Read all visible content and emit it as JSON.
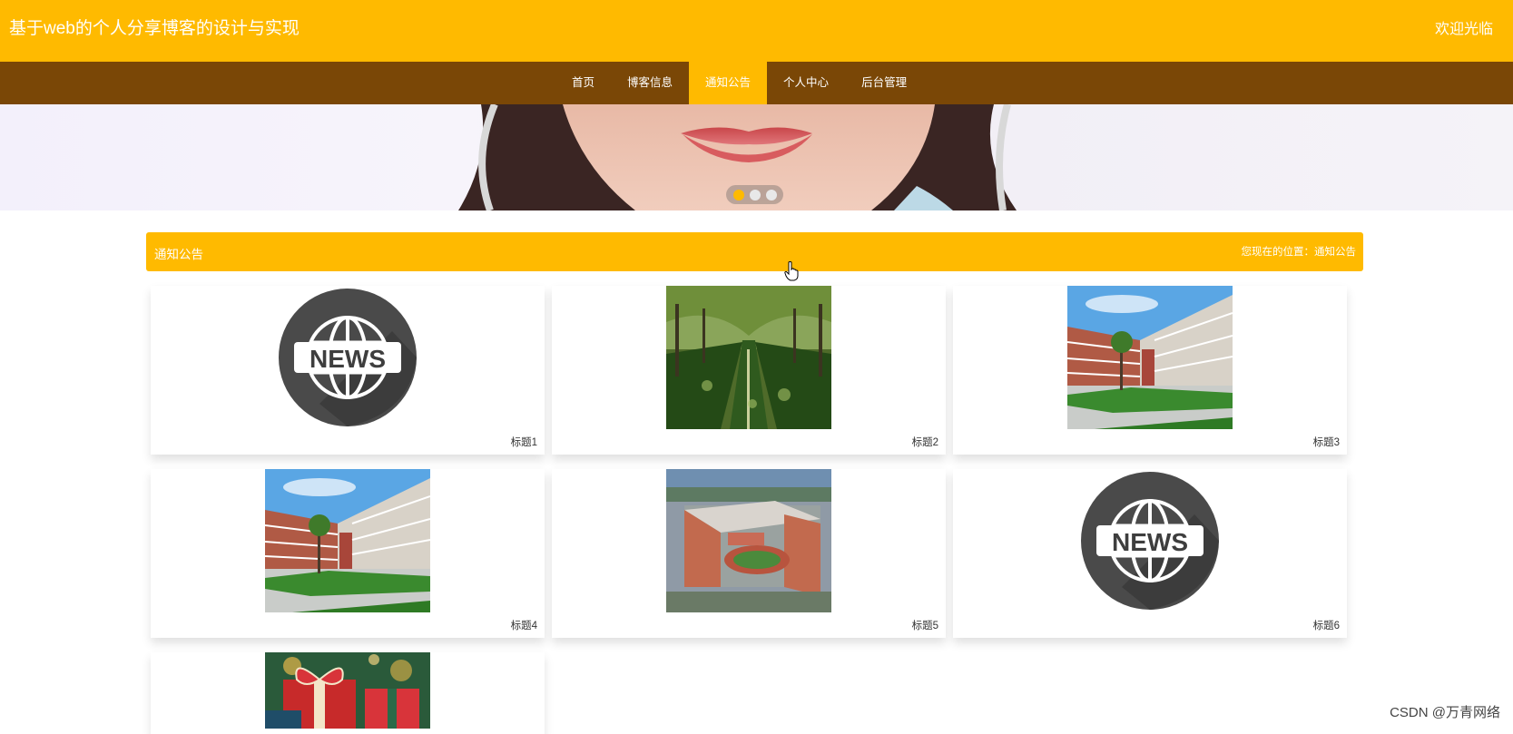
{
  "header": {
    "site_title": "基于web的个人分享博客的设计与实现",
    "welcome": "欢迎光临"
  },
  "nav": {
    "items": [
      {
        "label": "首页"
      },
      {
        "label": "博客信息"
      },
      {
        "label": "通知公告"
      },
      {
        "label": "个人中心"
      },
      {
        "label": "后台管理"
      }
    ],
    "active_index": 2
  },
  "carousel": {
    "slide_count": 3,
    "active_index": 0
  },
  "section": {
    "title": "通知公告",
    "location": "您现在的位置：通知公告"
  },
  "notices": [
    {
      "title": "标题1",
      "image": "news-globe-icon"
    },
    {
      "title": "标题2",
      "image": "tree-lined-road-photo"
    },
    {
      "title": "标题3",
      "image": "campus-building-photo"
    },
    {
      "title": "标题4",
      "image": "campus-building-photo"
    },
    {
      "title": "标题5",
      "image": "campus-aerial-photo"
    },
    {
      "title": "标题6",
      "image": "news-globe-icon"
    },
    {
      "title": "",
      "image": "christmas-gift-photo"
    }
  ],
  "watermark": "CSDN @万青网络",
  "colors": {
    "accent": "#ffba00",
    "nav_bg": "#7a4706",
    "text": "#333333"
  }
}
